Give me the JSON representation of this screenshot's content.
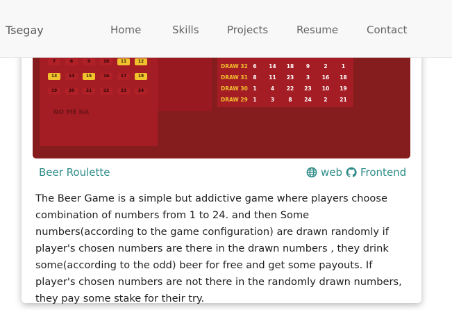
{
  "navbar": {
    "brand": "Tsegay",
    "links": [
      "Home",
      "Skills",
      "Projects",
      "Resume",
      "Contact"
    ]
  },
  "project": {
    "title": "Beer Roulette",
    "web_label": "web",
    "frontend_label": "Frontend",
    "description": "The Beer Game is a simple but addictive game where players choose combination of numbers from 1 to 24. and then Some numbers(according to the game configuration) are drawn randomly if player's chosen numbers are there in the drawn numbers , they drink some(according to the odd) beer for free and get some payouts. If player's chosen numbers are not there in the randomly drawn numbers, they pay some stake for their try."
  },
  "screenshot": {
    "grid_rows": [
      [
        "7",
        "8",
        "9",
        "10",
        "11",
        "12"
      ],
      [
        "13",
        "14",
        "15",
        "16",
        "17",
        "18"
      ],
      [
        "19",
        "20",
        "21",
        "22",
        "23",
        "24"
      ]
    ],
    "highlighted": [
      "11",
      "12",
      "13",
      "15",
      "18"
    ],
    "faint_label": "NO ME NA",
    "draws": [
      {
        "label": "DRAW 32",
        "nums": [
          "6",
          "14",
          "18",
          "9",
          "2",
          "1"
        ]
      },
      {
        "label": "DRAW 31",
        "nums": [
          "8",
          "11",
          "23",
          "3",
          "16",
          "18"
        ]
      },
      {
        "label": "DRAW 30",
        "nums": [
          "1",
          "4",
          "22",
          "23",
          "10",
          "19"
        ]
      },
      {
        "label": "DRAW 29",
        "nums": [
          "1",
          "3",
          "8",
          "24",
          "2",
          "21"
        ]
      }
    ]
  },
  "colors": {
    "accent": "#2f8c88",
    "screenshot_bg": "#851c1e",
    "highlight": "#f2c12e"
  }
}
